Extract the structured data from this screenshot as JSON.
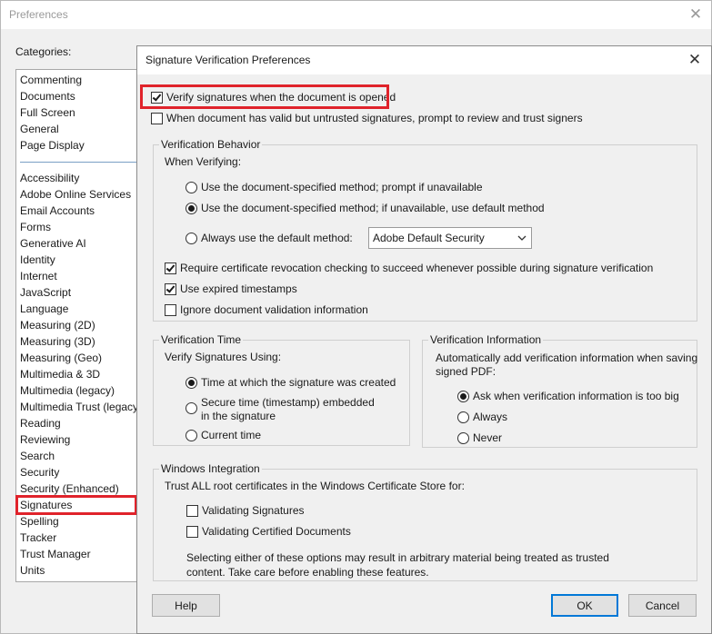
{
  "prefs_window": {
    "title": "Preferences",
    "close_glyph": "✕",
    "categories_label": "Categories:",
    "categories_top": [
      "Commenting",
      "Documents",
      "Full Screen",
      "General",
      "Page Display"
    ],
    "categories": [
      "Accessibility",
      "Adobe Online Services",
      "Email Accounts",
      "Forms",
      "Generative AI",
      "Identity",
      "Internet",
      "JavaScript",
      "Language",
      "Measuring (2D)",
      "Measuring (3D)",
      "Measuring (Geo)",
      "Multimedia & 3D",
      "Multimedia (legacy)",
      "Multimedia Trust (legacy)",
      "Reading",
      "Reviewing",
      "Search",
      "Security",
      "Security (Enhanced)",
      "Signatures",
      "Spelling",
      "Tracker",
      "Trust Manager",
      "Units"
    ],
    "selected_category": "Signatures"
  },
  "dialog": {
    "title": "Signature Verification Preferences",
    "close_glyph": "✕",
    "verify_on_open": {
      "label": "Verify signatures when the document is opened",
      "checked": true
    },
    "prompt_untrusted": {
      "label": "When document has valid but untrusted signatures, prompt to review and trust signers",
      "checked": false
    },
    "verification_behavior": {
      "title": "Verification Behavior",
      "when_verifying": "When Verifying:",
      "options": [
        {
          "label": "Use the document-specified method; prompt if unavailable",
          "selected": false
        },
        {
          "label": "Use the document-specified method; if unavailable, use default method",
          "selected": true
        },
        {
          "label": "Always use the default method:",
          "selected": false
        }
      ],
      "default_method": "Adobe Default Security",
      "checkboxes": [
        {
          "label": "Require certificate revocation checking to succeed whenever possible during signature verification",
          "checked": true
        },
        {
          "label": "Use expired timestamps",
          "checked": true
        },
        {
          "label": "Ignore document validation information",
          "checked": false
        }
      ]
    },
    "verification_time": {
      "title": "Verification Time",
      "subtitle": "Verify Signatures Using:",
      "options": [
        {
          "label": "Time at which the signature was created",
          "selected": true
        },
        {
          "label": "Secure time (timestamp) embedded",
          "label2": "in the signature",
          "selected": false
        },
        {
          "label": "Current time",
          "selected": false
        }
      ]
    },
    "verification_information": {
      "title": "Verification Information",
      "description": [
        "Automatically add verification information when saving",
        "signed PDF:"
      ],
      "options": [
        {
          "label": "Ask when verification information is too big",
          "selected": true
        },
        {
          "label": "Always",
          "selected": false
        },
        {
          "label": "Never",
          "selected": false
        }
      ]
    },
    "windows_integration": {
      "title": "Windows Integration",
      "description": "Trust ALL root certificates in the Windows Certificate Store for:",
      "checkboxes": [
        {
          "label": "Validating Signatures",
          "checked": false
        },
        {
          "label": "Validating Certified Documents",
          "checked": false
        }
      ],
      "warning": [
        "Selecting either of these options may result in arbitrary material being treated as trusted",
        "content. Take care before enabling these features."
      ]
    },
    "buttons": {
      "help": "Help",
      "ok": "OK",
      "cancel": "Cancel"
    }
  }
}
